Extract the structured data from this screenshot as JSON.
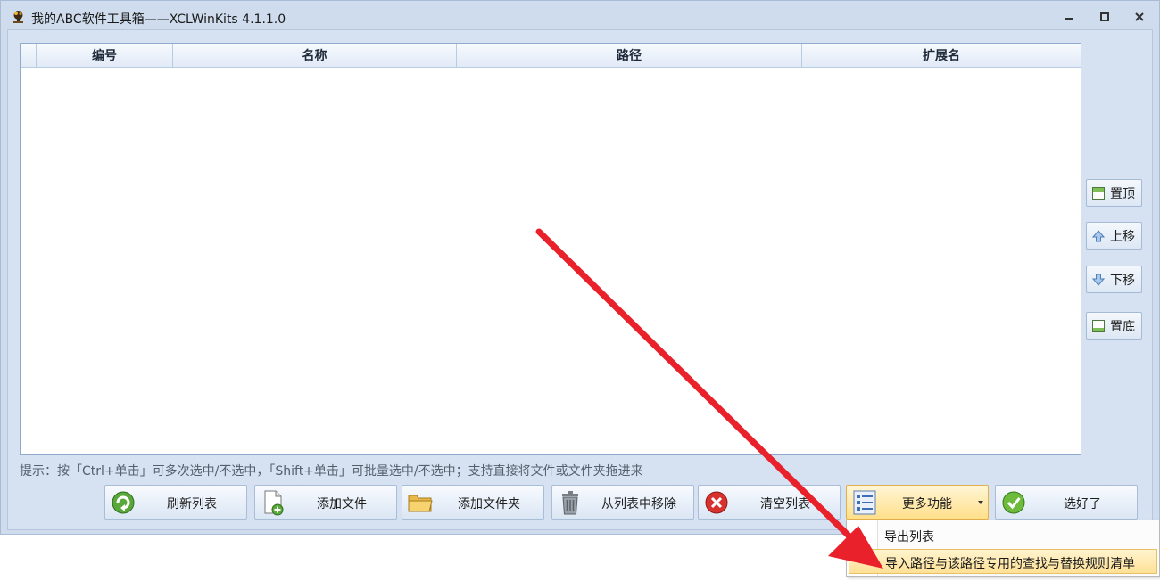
{
  "window": {
    "title": "我的ABC软件工具箱——XCLWinKits  4.1.1.0"
  },
  "list": {
    "columns": [
      "编号",
      "名称",
      "路径",
      "扩展名"
    ],
    "rows": []
  },
  "side_buttons": {
    "top": "置顶",
    "up": "上移",
    "down": "下移",
    "bottom": "置底"
  },
  "hint": "提示：按「Ctrl+单击」可多次选中/不选中，「Shift+单击」可批量选中/不选中；支持直接将文件或文件夹拖进来",
  "buttons": {
    "refresh": "刷新列表",
    "add_file": "添加文件",
    "add_folder": "添加文件夹",
    "remove": "从列表中移除",
    "clear": "清空列表",
    "more": "更多功能",
    "done": "选好了"
  },
  "menu": {
    "items": [
      {
        "label": "导出列表"
      },
      {
        "label": "导入路径与该路径专用的查找与替换规则清单"
      }
    ]
  },
  "colors": {
    "window_bg": "#cfdcee",
    "accent_hover": "#ffe196",
    "annotation_arrow": "#e8212b"
  },
  "icons": {
    "app": "app-logo-icon",
    "refresh": "refresh-icon",
    "add_file": "add-file-icon",
    "add_folder": "folder-icon",
    "remove": "trash-icon",
    "clear": "clear-icon",
    "more": "menu-list-icon",
    "done": "checkmark-icon"
  }
}
